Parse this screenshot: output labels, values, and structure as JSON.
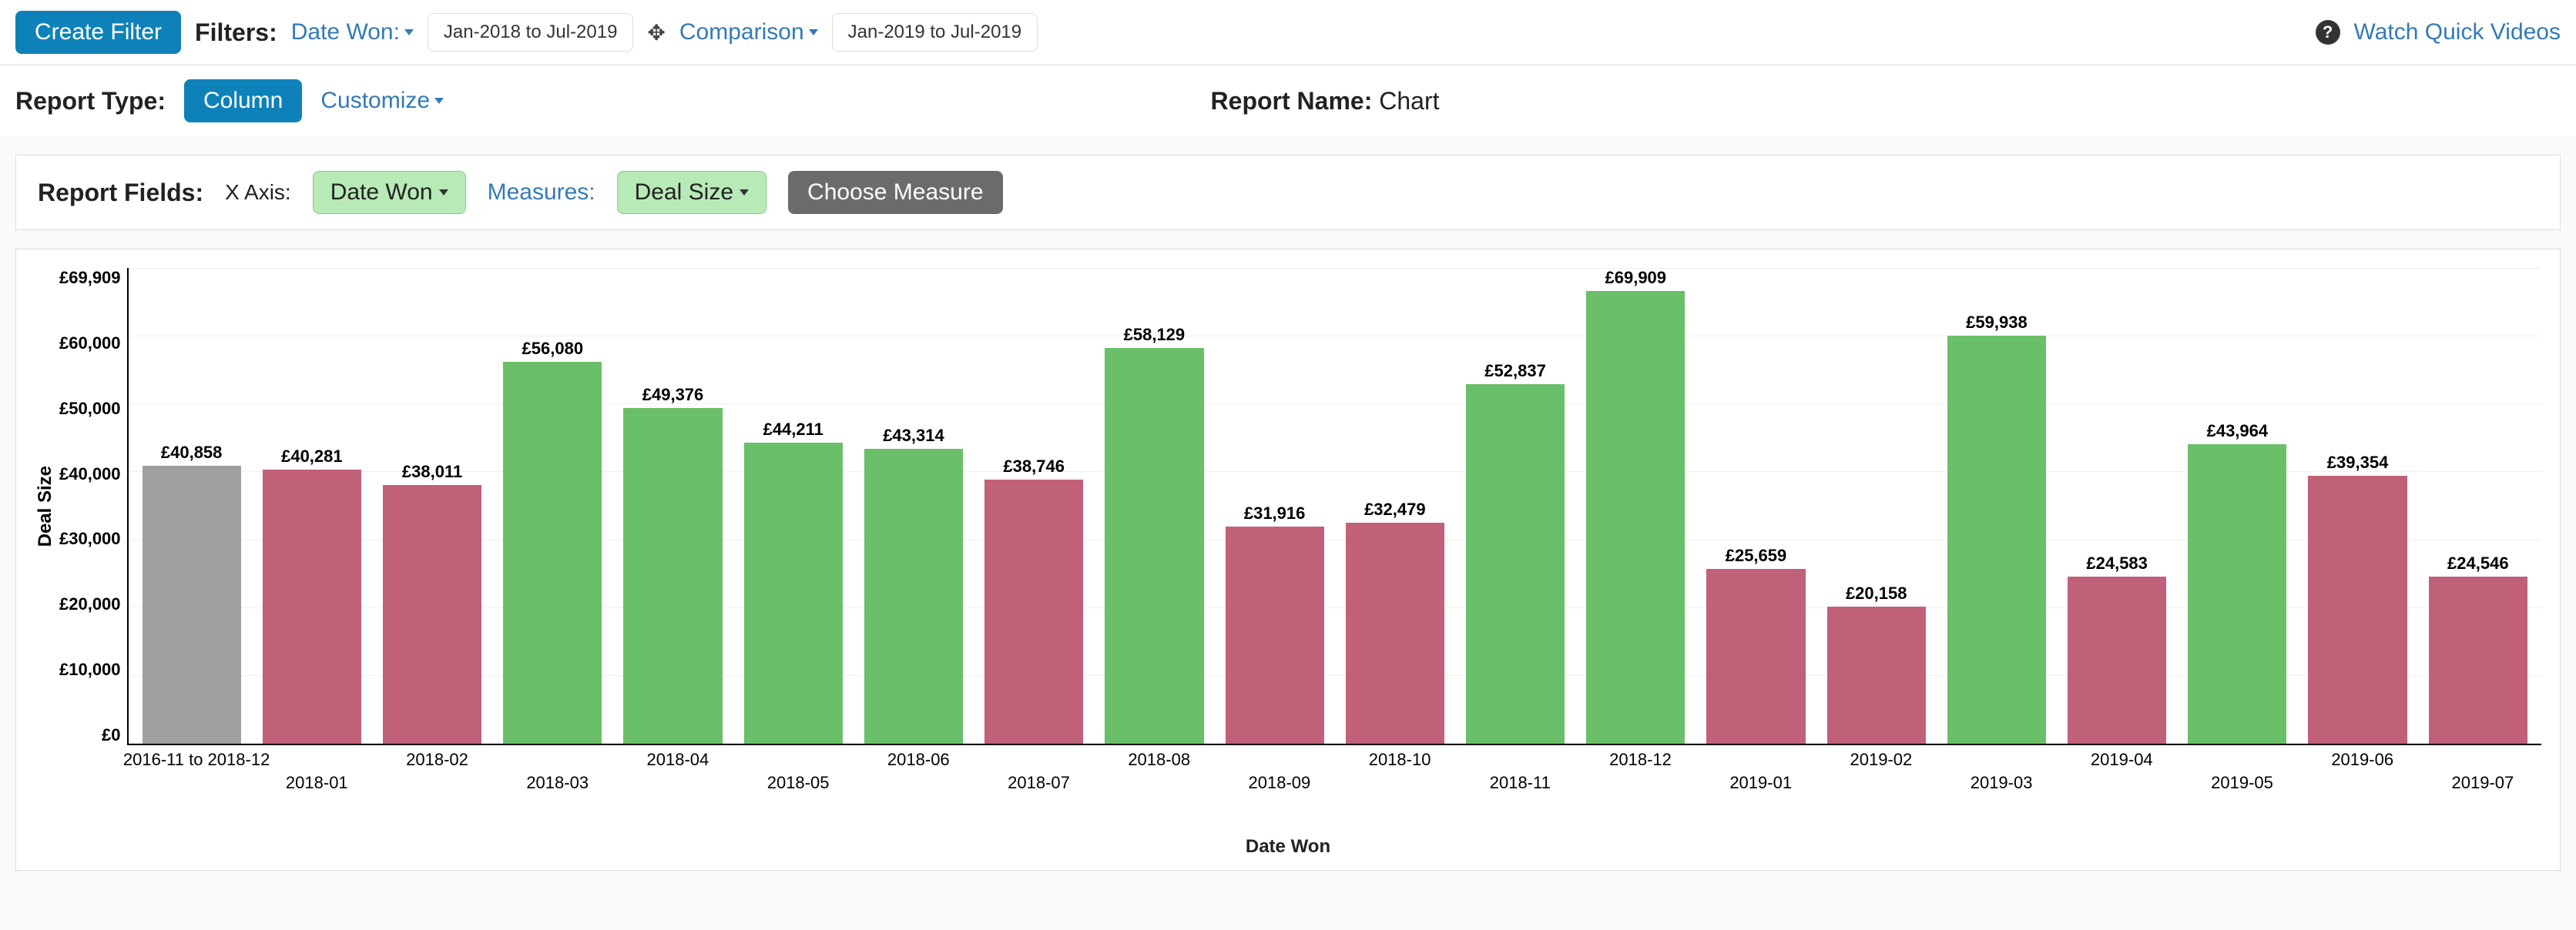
{
  "topbar": {
    "create_filter": "Create Filter",
    "filters_label": "Filters:",
    "filter1_link": "Date Won:",
    "filter1_range": "Jan-2018 to Jul-2019",
    "comparison_link": "Comparison",
    "comparison_range": "Jan-2019 to Jul-2019",
    "watch_link": "Watch Quick Videos"
  },
  "row2": {
    "report_type_label": "Report Type:",
    "column_btn": "Column",
    "customize_link": "Customize",
    "report_name_label": "Report Name:",
    "report_name_value": "Chart"
  },
  "fields": {
    "report_fields_label": "Report Fields:",
    "xaxis_label": "X Axis:",
    "xaxis_value": "Date Won",
    "measures_label": "Measures:",
    "measure_value": "Deal Size",
    "choose_measure_btn": "Choose Measure"
  },
  "chart_data": {
    "type": "bar",
    "title": "",
    "xlabel": "Date Won",
    "ylabel": "Deal Size",
    "ylim": [
      0,
      69909
    ],
    "yticks": [
      "£69,909",
      "£60,000",
      "£50,000",
      "£40,000",
      "£30,000",
      "£20,000",
      "£10,000",
      "£0"
    ],
    "currency": "£",
    "series": [
      {
        "category": "2016-11 to 2018-12",
        "value": 40858,
        "label": "£40,858",
        "color": "gray"
      },
      {
        "category": "2018-01",
        "value": 40281,
        "label": "£40,281",
        "color": "red"
      },
      {
        "category": "2018-02",
        "value": 38011,
        "label": "£38,011",
        "color": "red"
      },
      {
        "category": "2018-03",
        "value": 56080,
        "label": "£56,080",
        "color": "green"
      },
      {
        "category": "2018-04",
        "value": 49376,
        "label": "£49,376",
        "color": "green"
      },
      {
        "category": "2018-05",
        "value": 44211,
        "label": "£44,211",
        "color": "green"
      },
      {
        "category": "2018-06",
        "value": 43314,
        "label": "£43,314",
        "color": "green"
      },
      {
        "category": "2018-07",
        "value": 38746,
        "label": "£38,746",
        "color": "red"
      },
      {
        "category": "2018-08",
        "value": 58129,
        "label": "£58,129",
        "color": "green"
      },
      {
        "category": "2018-09",
        "value": 31916,
        "label": "£31,916",
        "color": "red"
      },
      {
        "category": "2018-10",
        "value": 32479,
        "label": "£32,479",
        "color": "red"
      },
      {
        "category": "2018-11",
        "value": 52837,
        "label": "£52,837",
        "color": "green"
      },
      {
        "category": "2018-12",
        "value": 69909,
        "label": "£69,909",
        "color": "green"
      },
      {
        "category": "2019-01",
        "value": 25659,
        "label": "£25,659",
        "color": "red"
      },
      {
        "category": "2019-02",
        "value": 20158,
        "label": "£20,158",
        "color": "red"
      },
      {
        "category": "2019-03",
        "value": 59938,
        "label": "£59,938",
        "color": "green"
      },
      {
        "category": "2019-04",
        "value": 24583,
        "label": "£24,583",
        "color": "red"
      },
      {
        "category": "2019-05",
        "value": 43964,
        "label": "£43,964",
        "color": "green"
      },
      {
        "category": "2019-06",
        "value": 39354,
        "label": "£39,354",
        "color": "red"
      },
      {
        "category": "2019-07",
        "value": 24546,
        "label": "£24,546",
        "color": "red"
      }
    ]
  }
}
